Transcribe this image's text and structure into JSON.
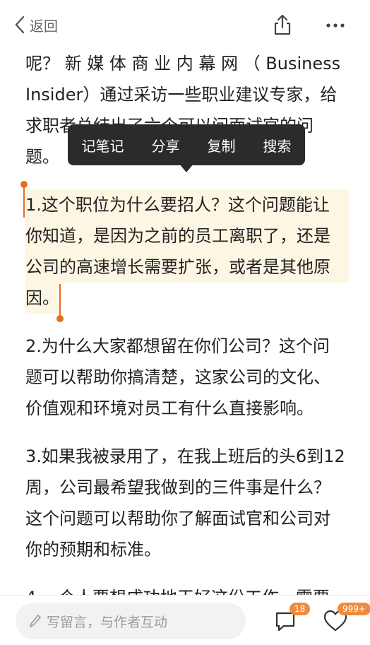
{
  "topbar": {
    "back_label": "返回"
  },
  "article": {
    "p0_lines": [
      "呢？ 新 媒 体 商 业 内 幕 网 （ Business",
      "Insider）通过采访一些职业建议专家，给",
      "求职者总结出了六个可以问面试官的问",
      "题。"
    ],
    "p1_lines": [
      "1.这个职位为什么要招人？这个问题能让",
      "你知道，是因为之前的员工离职了，还是",
      "公司的高速增长需要扩张，或者是其他原",
      "因。"
    ],
    "p2_lines": [
      "2.为什么大家都想留在你们公司？这个问",
      "题可以帮助你搞清楚，这家公司的文化、",
      "价值观和环境对员工有什么直接影响。"
    ],
    "p3_lines": [
      "3.如果我被录用了，在我上班后的头6到12",
      "周，公司最希望我做到的三件事是什么？",
      "这个问题可以帮助你了解面试官和公司对",
      "你的预期和标准。"
    ],
    "p4_lines": [
      "4.一个人要想成功地干好这份工作，需要"
    ]
  },
  "popup": {
    "items": [
      "记笔记",
      "分享",
      "复制",
      "搜索"
    ]
  },
  "bottombar": {
    "comment_placeholder": "写留言，与作者互动",
    "comment_count": "18",
    "like_count": "999+"
  },
  "colors": {
    "accent": "#e36f1e",
    "badge": "#f08a3e",
    "highlight": "#fdf6e3",
    "popup": "#2b2b2b"
  }
}
